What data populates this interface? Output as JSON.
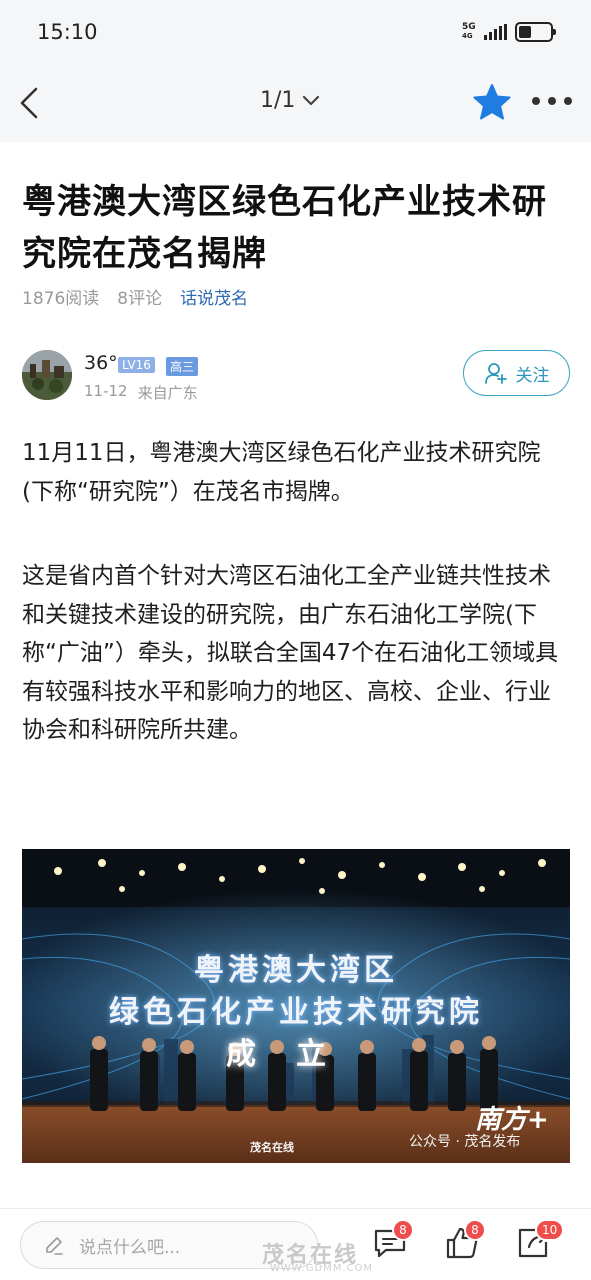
{
  "status_bar": {
    "time": "15:10",
    "network_label_top": "5G",
    "network_label_bottom": "4G",
    "battery_level_percent": 40
  },
  "nav": {
    "page_indicator": "1/1",
    "star_color": "#1f7ce0"
  },
  "article": {
    "title": "粤港澳大湾区绿色石化产业技术研究院在茂名揭牌",
    "reads": "1876阅读",
    "comments": "8评论",
    "topic": "话说茂名"
  },
  "author": {
    "name": "36°",
    "level": "LV16",
    "grade": "高三",
    "date": "11-12",
    "location": "来自广东",
    "follow_label": "关注"
  },
  "content": {
    "paragraph_1": "11月11日，粤港澳大湾区绿色石化产业技术研究院(下称“研究院”）在茂名市揭牌。",
    "paragraph_2": "这是省内首个针对大湾区石油化工全产业链共性技术和关键技术建设的研究院，由广东石油化工学院(下称“广油”）牵头，拟联合全国47个在石油化工领域具有较强科技水平和影响力的地区、高校、企业、行业协会和科研院所共建。"
  },
  "photo": {
    "sign_line_1": "粤港澳大湾区",
    "sign_line_2": "绿色石化产业技术研究院",
    "sign_line_3": "成立",
    "watermark_left": "茂名在线",
    "watermark_right": "公众号 · 茂名发布",
    "brand": "南方+"
  },
  "bottom_bar": {
    "comment_placeholder": "说点什么吧...",
    "comment_count": "8",
    "like_count": "8",
    "share_count": "10",
    "watermark": "茂名在线",
    "watermark_url": "WWW.GDMM.COM"
  }
}
